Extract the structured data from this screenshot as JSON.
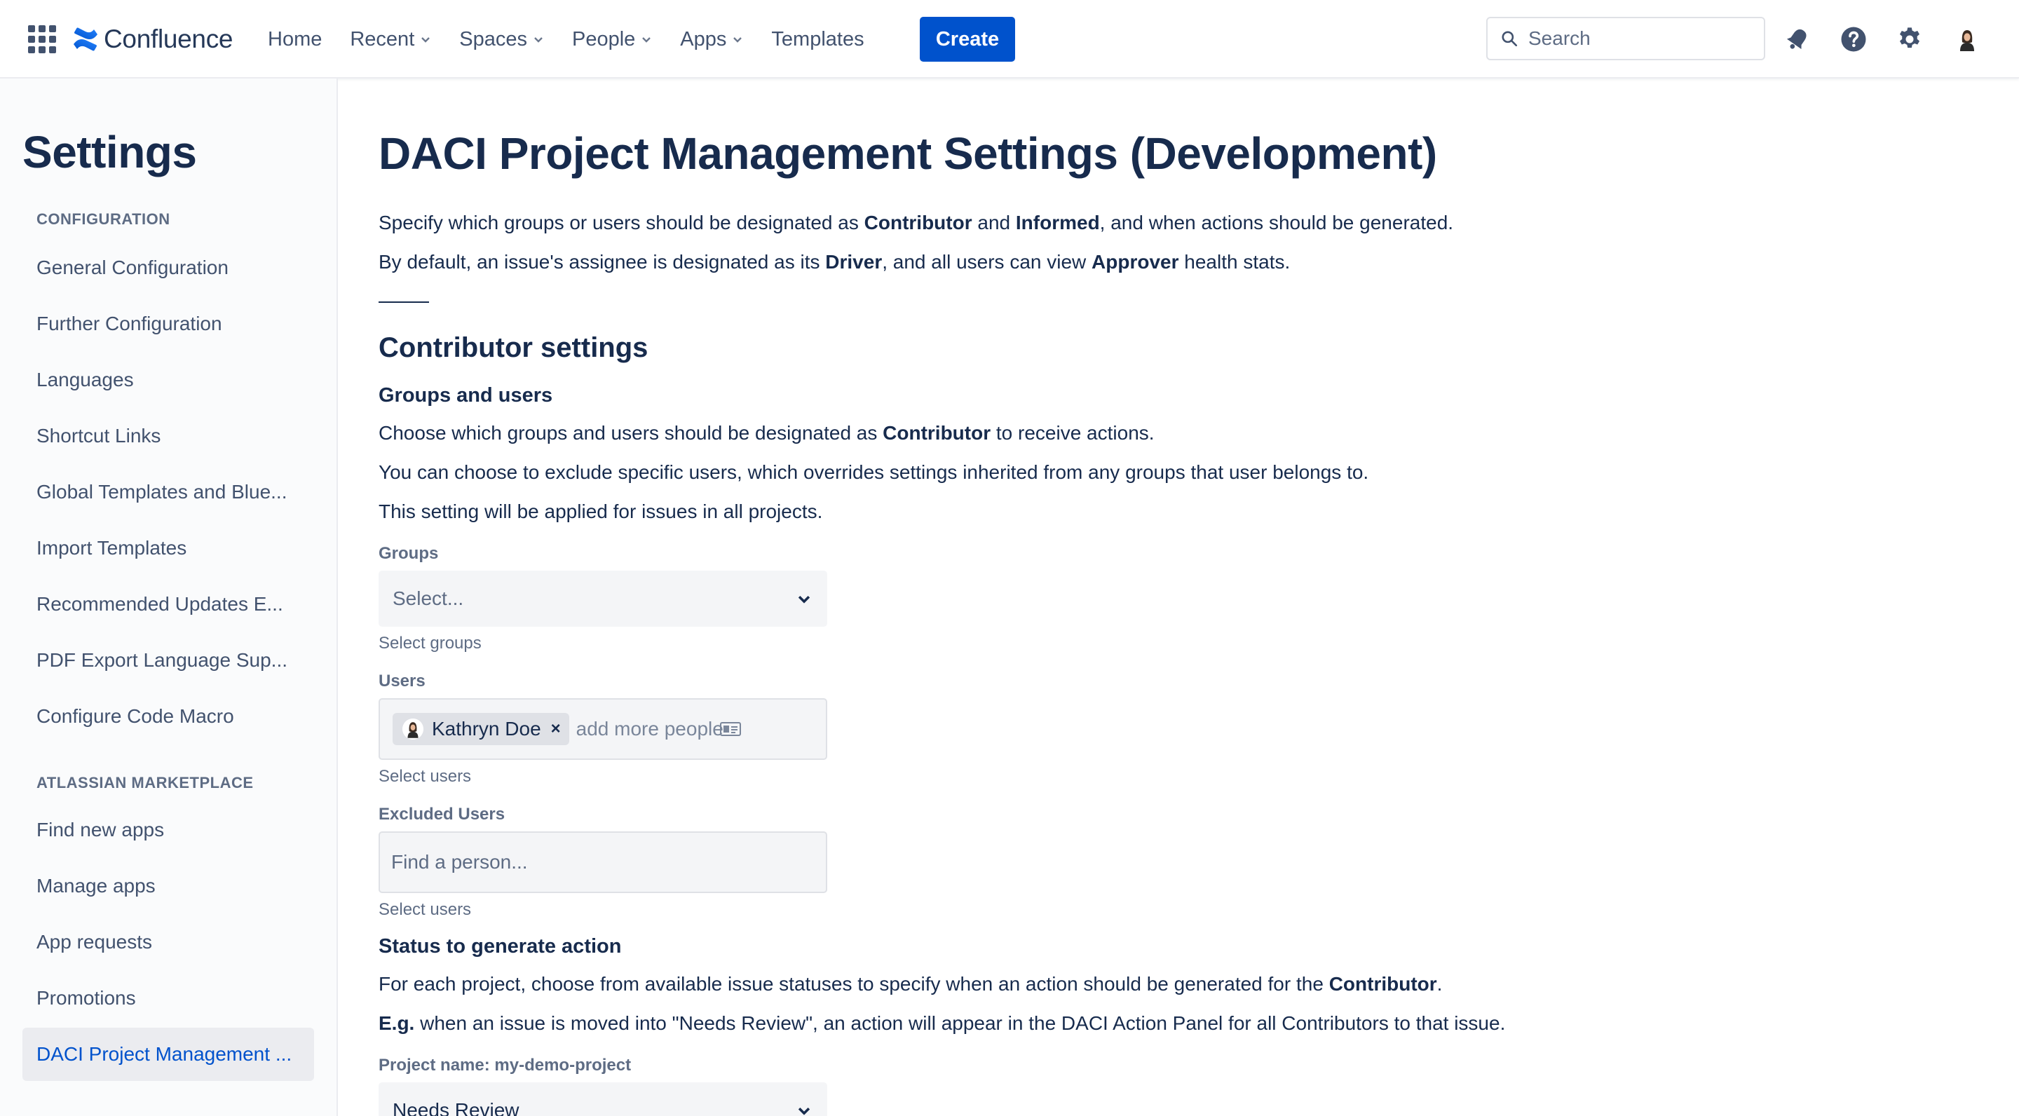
{
  "topnav": {
    "logo_text": "Confluence",
    "items": [
      {
        "label": "Home",
        "has_dropdown": false
      },
      {
        "label": "Recent",
        "has_dropdown": true
      },
      {
        "label": "Spaces",
        "has_dropdown": true
      },
      {
        "label": "People",
        "has_dropdown": true
      },
      {
        "label": "Apps",
        "has_dropdown": true
      },
      {
        "label": "Templates",
        "has_dropdown": false
      }
    ],
    "create_label": "Create",
    "search_placeholder": "Search",
    "icons": [
      "app-switcher-icon",
      "notifications-icon",
      "help-icon",
      "settings-icon",
      "avatar"
    ]
  },
  "sidebar": {
    "title": "Settings",
    "sections": [
      {
        "heading": "CONFIGURATION",
        "items": [
          "General Configuration",
          "Further Configuration",
          "Languages",
          "Shortcut Links",
          "Global Templates and Blue...",
          "Import Templates",
          "Recommended Updates E...",
          "PDF Export Language Sup...",
          "Configure Code Macro"
        ]
      },
      {
        "heading": "ATLASSIAN MARKETPLACE",
        "items": [
          "Find new apps",
          "Manage apps",
          "App requests",
          "Promotions",
          "DACI Project Management ..."
        ]
      }
    ],
    "active_item": "DACI Project Management ..."
  },
  "main": {
    "title": "DACI Project Management Settings (Development)",
    "intro1": {
      "p1": "Specify which groups or users should be designated as ",
      "b1": "Contributor",
      "p2": " and ",
      "b2": "Informed",
      "p3": ", and when actions should be generated."
    },
    "intro2": {
      "p1": "By default, an issue's assignee is designated as its ",
      "b1": "Driver",
      "p2": ", and all users can view ",
      "b2": "Approver",
      "p3": " health stats."
    },
    "contributor_heading": "Contributor settings",
    "groups_users_heading": "Groups and users",
    "desc1": {
      "p1": "Choose which groups and users should be designated as ",
      "b1": "Contributor",
      "p2": " to receive actions."
    },
    "desc2": "You can choose to exclude specific users, which overrides settings inherited from any groups that user belongs to.",
    "desc3": "This setting will be applied for issues in all projects.",
    "groups": {
      "label": "Groups",
      "placeholder": "Select...",
      "helper": "Select groups"
    },
    "users": {
      "label": "Users",
      "selected": [
        "Kathryn Doe"
      ],
      "remove_symbol": "×",
      "placeholder": "add more people...",
      "helper": "Select users"
    },
    "excluded_users": {
      "label": "Excluded Users",
      "placeholder": "Find a person...",
      "helper": "Select users"
    },
    "status_heading": "Status to generate action",
    "status_desc1": {
      "p1": "For each project, choose from available issue statuses to specify when an action should be generated for the ",
      "b1": "Contributor",
      "p2": "."
    },
    "status_desc2": {
      "b1": "E.g.",
      "p1": " when an issue is moved into \"Needs Review\", an action will appear in the DACI Action Panel for all Contributors to that issue."
    },
    "project": {
      "label": "Project name: my-demo-project",
      "value": "Needs Review"
    }
  },
  "colors": {
    "brand_blue": "#0052cc",
    "text": "#172b4d",
    "subtle_text": "#5e6c84",
    "field_bg": "#f4f5f7"
  }
}
